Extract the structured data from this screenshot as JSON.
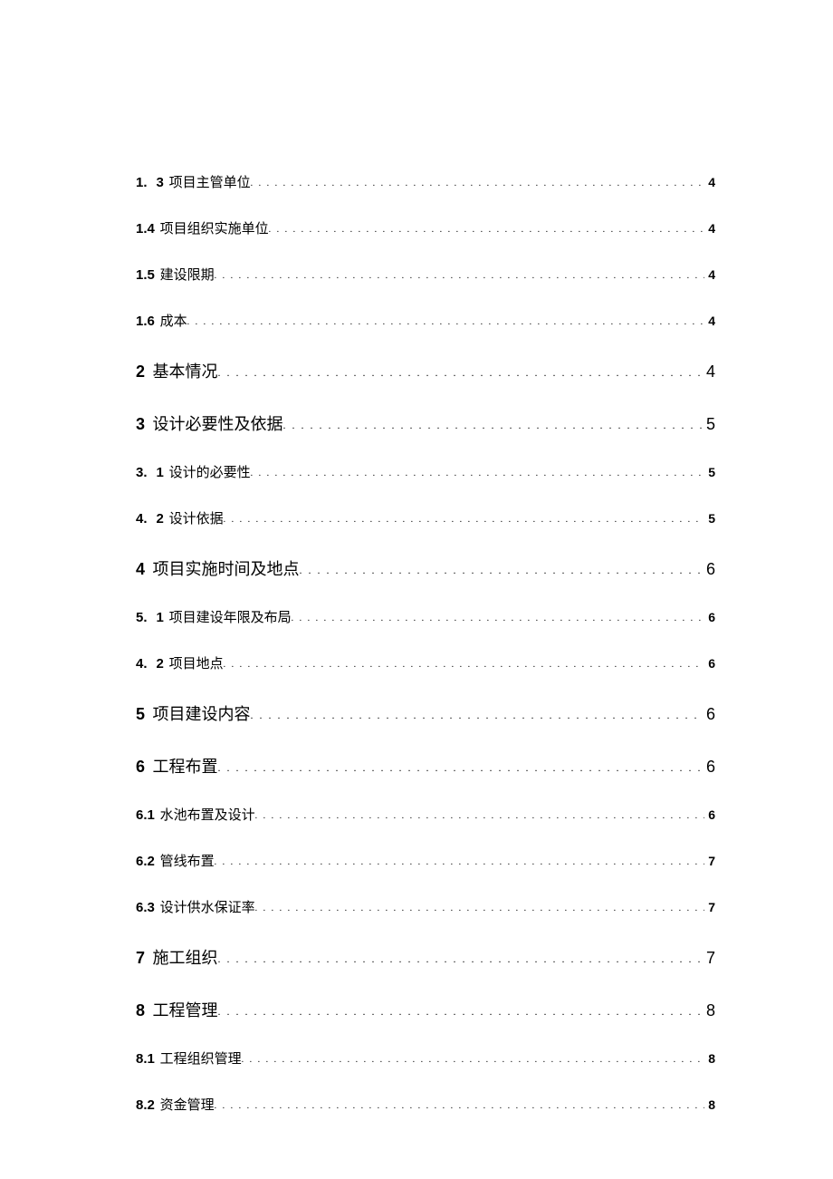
{
  "toc": [
    {
      "level": 2,
      "wide": true,
      "num_a": "1.",
      "num_b": "3",
      "title": "项目主管单位",
      "page": "4"
    },
    {
      "level": 2,
      "wide": false,
      "num": "1.4",
      "title": "项目组织实施单位",
      "page": "4"
    },
    {
      "level": 2,
      "wide": false,
      "num": "1.5",
      "title": "建设限期",
      "page": "4"
    },
    {
      "level": 2,
      "wide": false,
      "num": "1.6",
      "title": "成本",
      "page": "4"
    },
    {
      "level": 1,
      "num": "2",
      "title": "基本情况",
      "page": "4"
    },
    {
      "level": 1,
      "num": "3",
      "title": "设计必要性及依据",
      "page": "5"
    },
    {
      "level": 2,
      "wide": true,
      "num_a": "3.",
      "num_b": "1",
      "title": "设计的必要性",
      "page": "5"
    },
    {
      "level": 2,
      "wide": true,
      "num_a": "4.",
      "num_b": "2",
      "title": "设计依据",
      "page": "5"
    },
    {
      "level": 1,
      "num": "4",
      "title": "项目实施时间及地点",
      "page": "6"
    },
    {
      "level": 2,
      "wide": true,
      "num_a": "5.",
      "num_b": "1",
      "title": "项目建设年限及布局",
      "page": "6"
    },
    {
      "level": 2,
      "wide": true,
      "num_a": "4.",
      "num_b": "2",
      "title": "项目地点",
      "page": "6"
    },
    {
      "level": 1,
      "num": "5",
      "title": "项目建设内容",
      "page": "6"
    },
    {
      "level": 1,
      "num": "6",
      "title": "工程布置",
      "page": "6"
    },
    {
      "level": 2,
      "wide": false,
      "num": "6.1",
      "title": "水池布置及设计",
      "page": "6"
    },
    {
      "level": 2,
      "wide": false,
      "num": "6.2",
      "title": "管线布置",
      "page": "7"
    },
    {
      "level": 2,
      "wide": false,
      "num": "6.3",
      "title": "设计供水保证率",
      "page": "7"
    },
    {
      "level": 1,
      "num": "7",
      "title": "施工组织",
      "page": "7"
    },
    {
      "level": 1,
      "num": "8",
      "title": "工程管理",
      "page": "8"
    },
    {
      "level": 2,
      "wide": false,
      "num": "8.1",
      "title": "工程组织管理",
      "page": "8"
    },
    {
      "level": 2,
      "wide": false,
      "num": "8.2",
      "title": "资金管理",
      "page": "8"
    }
  ]
}
